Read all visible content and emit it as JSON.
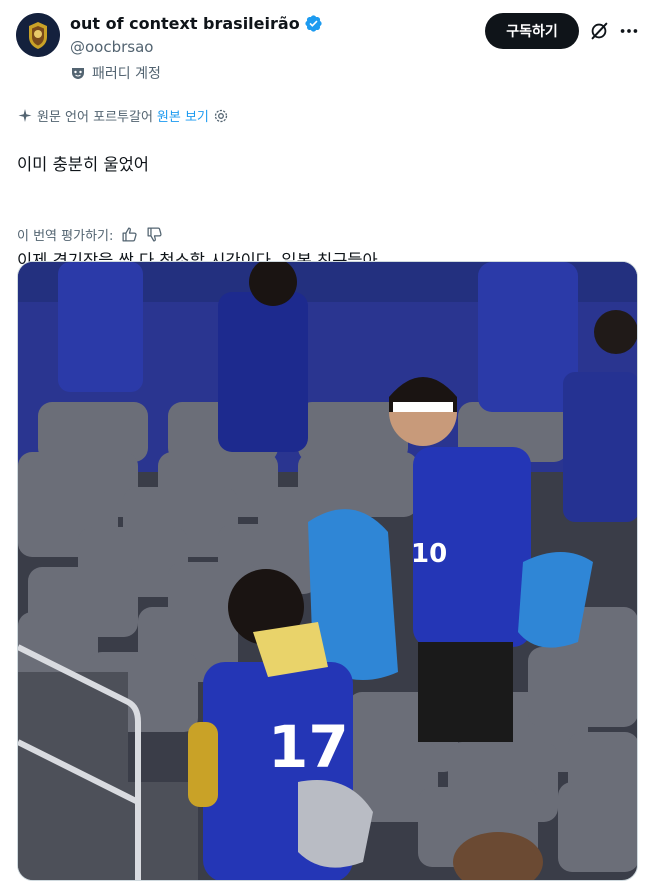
{
  "author": {
    "display_name": "out of context brasileirão",
    "handle": "@oocbrsao",
    "parody_label": "패러디 계정",
    "avatar_icon": "team-crest-icon",
    "verified_icon": "verified-badge-icon"
  },
  "actions": {
    "subscribe_label": "구독하기",
    "grok_icon": "grok-icon",
    "more_icon": "more-dots-icon"
  },
  "translation": {
    "notice": "원문 언어 포르투갈어",
    "view_original": "원본 보기",
    "rate_label": "이 번역 평가하기:"
  },
  "tweet": {
    "line1": "이미 충분히 울었어",
    "line2": "이제 경기장을 싹 다 청소할 시간이다, 일본 친구들아"
  },
  "media": {
    "jersey_number_front": "10",
    "jersey_number_back": "17"
  },
  "colors": {
    "accent": "#1d9bf0",
    "text": "#0f1419",
    "muted": "#536471",
    "button_bg": "#0f1419"
  }
}
